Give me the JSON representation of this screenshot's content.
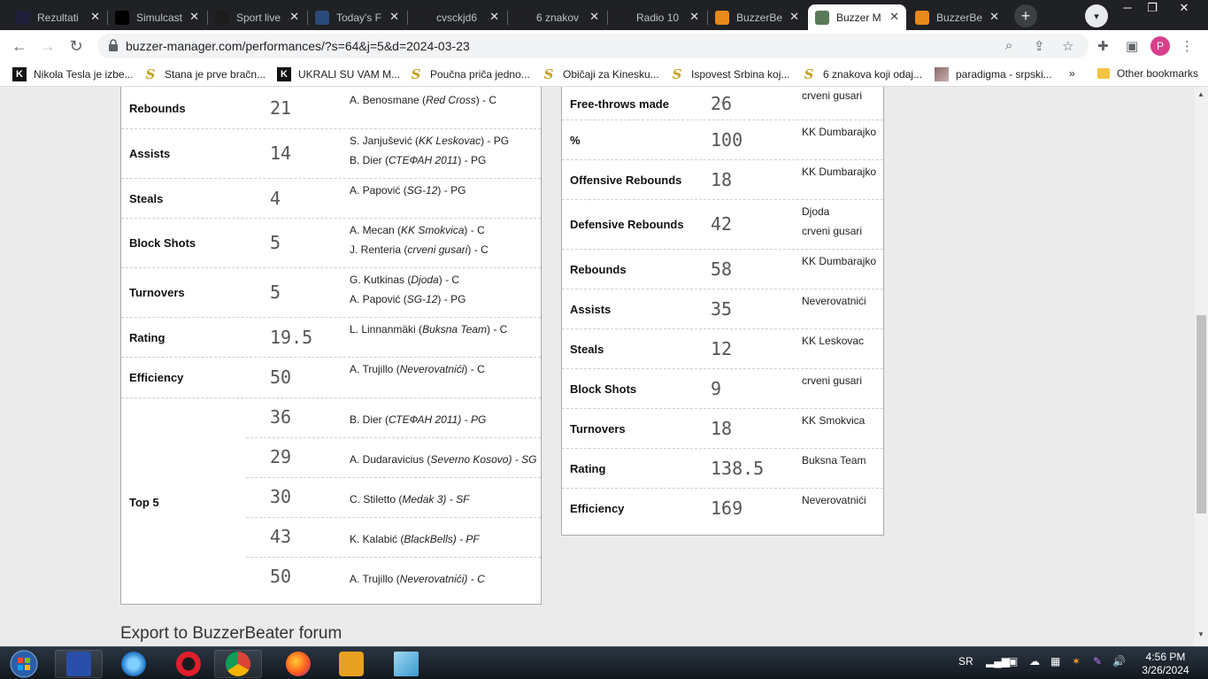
{
  "browser": {
    "tabs": [
      {
        "title": "Rezultati",
        "icon": "rezultati-icon",
        "color": "#1f1f3a"
      },
      {
        "title": "Simulcast",
        "icon": "play-icon",
        "color": "#000000"
      },
      {
        "title": "Sport live",
        "icon": "365-icon",
        "color": "#1c1c1c"
      },
      {
        "title": "Today's F",
        "icon": "b-icon",
        "color": "#2b4a7a"
      },
      {
        "title": "cvsckjd6",
        "icon": "loading-icon",
        "color": "#202124"
      },
      {
        "title": "6 znakov",
        "icon": "s-icon",
        "color": "#202124"
      },
      {
        "title": "Radio 10",
        "icon": "radio-icon",
        "color": "#202124"
      },
      {
        "title": "BuzzerBe",
        "icon": "basketball-icon",
        "color": "#e8891c"
      },
      {
        "title": "Buzzer M",
        "icon": "bm-icon",
        "color": "#5a7a5a"
      },
      {
        "title": "BuzzerBe",
        "icon": "basketball-icon",
        "color": "#e8891c"
      }
    ],
    "active_tab_index": 8,
    "new_tab_label": "+",
    "address_url": "buzzer-manager.com/performances/?s=64&j=5&d=2024-03-23",
    "profile_initial": "P",
    "bookmarks": [
      {
        "label": "Nikola Tesla je izbe...",
        "icon": "k-icon"
      },
      {
        "label": "Stana je prve bračn...",
        "icon": "s-icon"
      },
      {
        "label": "UKRALI SU VAM M...",
        "icon": "k-icon"
      },
      {
        "label": "Poučna priča jedno...",
        "icon": "s-icon"
      },
      {
        "label": "Običaji za Kinesku...",
        "icon": "s-icon"
      },
      {
        "label": "Ispovest Srbina koj...",
        "icon": "s-icon"
      },
      {
        "label": "6 znakova koji odaj...",
        "icon": "s-icon"
      },
      {
        "label": "paradigma - srpski...",
        "icon": "image-icon"
      }
    ],
    "bookmarks_overflow": "»",
    "other_bookmarks": "Other bookmarks"
  },
  "players_table": {
    "rows": [
      {
        "label": "Rebounds",
        "value": "21",
        "players": [
          {
            "name": "A. Benosmane",
            "team": "Red Cross",
            "pos": "C"
          }
        ]
      },
      {
        "label": "Assists",
        "value": "14",
        "players": [
          {
            "name": "S. Janjušević",
            "team": "KK Leskovac",
            "pos": "PG"
          },
          {
            "name": "B. Dier",
            "team": "СТЕФАН 2011",
            "pos": "PG"
          }
        ]
      },
      {
        "label": "Steals",
        "value": "4",
        "players": [
          {
            "name": "A. Papović",
            "team": "SG-12",
            "pos": "PG"
          }
        ]
      },
      {
        "label": "Block Shots",
        "value": "5",
        "players": [
          {
            "name": "A. Mecan",
            "team": "KK Smokvica",
            "pos": "C"
          },
          {
            "name": "J. Renteria",
            "team": "crveni gusari",
            "pos": "C"
          }
        ]
      },
      {
        "label": "Turnovers",
        "value": "5",
        "players": [
          {
            "name": "G. Kutkinas",
            "team": "Djoda",
            "pos": "C"
          },
          {
            "name": "A. Papović",
            "team": "SG-12",
            "pos": "PG"
          }
        ]
      },
      {
        "label": "Rating",
        "value": "19.5",
        "players": [
          {
            "name": "L. Linnanmäki",
            "team": "Buksna Team",
            "pos": "C"
          }
        ]
      },
      {
        "label": "Efficiency",
        "value": "50",
        "players": [
          {
            "name": "A. Trujillo",
            "team": "Neverovatnići",
            "pos": "C"
          }
        ]
      }
    ],
    "top5_label": "Top 5",
    "top5": [
      {
        "value": "36",
        "name": "B. Dier",
        "team": "СТЕФАН 2011",
        "pos": "PG"
      },
      {
        "value": "29",
        "name": "A. Dudaravicius",
        "team": "Severno Kosovo",
        "pos": "SG"
      },
      {
        "value": "30",
        "name": "C. Stiletto",
        "team": "Medak 3",
        "pos": "SF"
      },
      {
        "value": "43",
        "name": "K. Kalabić",
        "team": "BlackBells",
        "pos": "PF"
      },
      {
        "value": "50",
        "name": "A. Trujillo",
        "team": "Neverovatnići",
        "pos": "C"
      }
    ]
  },
  "teams_table": {
    "rows": [
      {
        "label": "Free-throws made",
        "value": "26",
        "teams": [
          "crveni gusari"
        ]
      },
      {
        "label": "%",
        "value": "100",
        "teams": [
          "KK Dumbarajko"
        ]
      },
      {
        "label": "Offensive Rebounds",
        "value": "18",
        "teams": [
          "KK Dumbarajko"
        ]
      },
      {
        "label": "Defensive Rebounds",
        "value": "42",
        "teams": [
          "Djoda",
          "crveni gusari"
        ]
      },
      {
        "label": "Rebounds",
        "value": "58",
        "teams": [
          "KK Dumbarajko"
        ]
      },
      {
        "label": "Assists",
        "value": "35",
        "teams": [
          "Neverovatnići"
        ]
      },
      {
        "label": "Steals",
        "value": "12",
        "teams": [
          "KK Leskovac"
        ]
      },
      {
        "label": "Block Shots",
        "value": "9",
        "teams": [
          "crveni gusari"
        ]
      },
      {
        "label": "Turnovers",
        "value": "18",
        "teams": [
          "KK Smokvica"
        ]
      },
      {
        "label": "Rating",
        "value": "138.5",
        "teams": [
          "Buksna Team"
        ]
      },
      {
        "label": "Efficiency",
        "value": "169",
        "teams": [
          "Neverovatnići"
        ]
      }
    ]
  },
  "export_link": "Export to BuzzerBeater forum",
  "taskbar": {
    "apps": [
      "save-app-icon",
      "internet-explorer-icon",
      "opera-icon",
      "chrome-icon",
      "firefox-icon",
      "media-player-icon",
      "notes-icon"
    ],
    "language": "SR",
    "time": "4:56 PM",
    "date": "3/26/2024"
  }
}
